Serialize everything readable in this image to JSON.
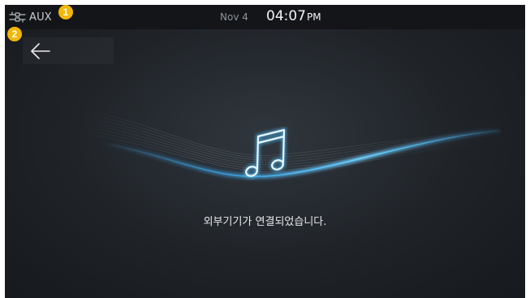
{
  "status_bar": {
    "source_label": "AUX",
    "source_icon": "aux-cable-icon",
    "date": "Nov 4",
    "time": "04:07",
    "ampm": "PM"
  },
  "badges": {
    "one": "1",
    "two": "2"
  },
  "navigation": {
    "back_icon": "back-arrow-icon"
  },
  "main": {
    "message": "외부기기가 연결되었습니다.",
    "icon": "music-note-icon"
  },
  "colors": {
    "accent_glow": "#3fb4ff",
    "badge": "#f2b705",
    "status_bar_bg": "#131518"
  }
}
